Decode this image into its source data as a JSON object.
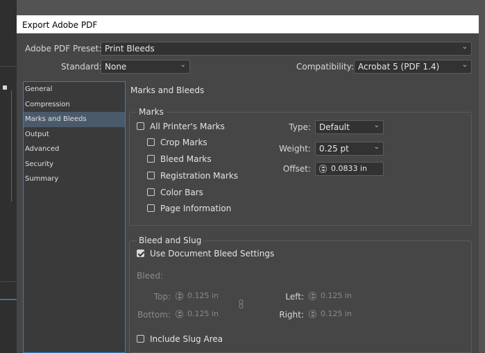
{
  "dialog": {
    "title": "Export Adobe PDF"
  },
  "preset": {
    "label": "Adobe PDF Preset:",
    "value": "Print Bleeds"
  },
  "standard": {
    "label": "Standard:",
    "value": "None"
  },
  "compatibility": {
    "label": "Compatibility:",
    "value": "Acrobat 5 (PDF 1.4)"
  },
  "sidebar": {
    "items": [
      {
        "label": "General",
        "active": false
      },
      {
        "label": "Compression",
        "active": false
      },
      {
        "label": "Marks and Bleeds",
        "active": true
      },
      {
        "label": "Output",
        "active": false
      },
      {
        "label": "Advanced",
        "active": false
      },
      {
        "label": "Security",
        "active": false
      },
      {
        "label": "Summary",
        "active": false
      }
    ]
  },
  "panel": {
    "title": "Marks and Bleeds"
  },
  "marks": {
    "group_label": "Marks",
    "all_printers": {
      "label": "All Printer's Marks",
      "checked": false
    },
    "crop": {
      "label": "Crop Marks",
      "checked": false
    },
    "bleed": {
      "label": "Bleed Marks",
      "checked": false
    },
    "registration": {
      "label": "Registration Marks",
      "checked": false
    },
    "color_bars": {
      "label": "Color Bars",
      "checked": false
    },
    "page_info": {
      "label": "Page Information",
      "checked": false
    },
    "type": {
      "label": "Type:",
      "value": "Default"
    },
    "weight": {
      "label": "Weight:",
      "value": "0.25 pt"
    },
    "offset": {
      "label": "Offset:",
      "value": "0.0833 in"
    }
  },
  "bleed_slug": {
    "group_label": "Bleed and Slug",
    "use_doc": {
      "label": "Use Document Bleed Settings",
      "checked": true
    },
    "bleed_label": "Bleed:",
    "top": {
      "label": "Top:",
      "value": "0.125 in"
    },
    "bottom": {
      "label": "Bottom:",
      "value": "0.125 in"
    },
    "left": {
      "label": "Left:",
      "value": "0.125 in"
    },
    "right": {
      "label": "Right:",
      "value": "0.125 in"
    },
    "include_slug": {
      "label": "Include Slug Area",
      "checked": false
    }
  },
  "icons": {
    "dropdown": "chevron-down-icon",
    "spinner": "stepper-icon",
    "link": "chain-link-icon"
  },
  "colors": {
    "accent": "#2f81c5",
    "selected": "#4b5a6b"
  }
}
